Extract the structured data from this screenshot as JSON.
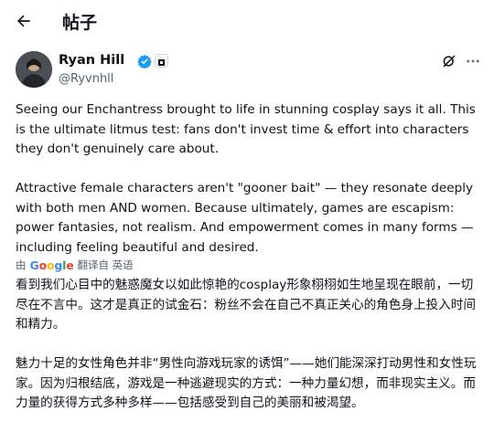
{
  "header": {
    "title": "帖子",
    "back_icon": "arrow-left-icon"
  },
  "author": {
    "name": "Ryan Hill",
    "handle": "@Ryvnhll",
    "verified_icon": "verified-badge-icon",
    "verified_color": "#1d9bf0"
  },
  "actions": {
    "grok_icon": "grok-icon",
    "more_icon": "more-dots-icon"
  },
  "tweet": {
    "text": "Seeing our Enchantress brought to life in stunning cosplay says it all. This is the ultimate litmus test: fans don't invest time & effort into characters they don't genuinely care about.\n\nAttractive female characters aren't \"gooner bait\" — they resonate deeply with both men AND women. Because ultimately, games are escapism: power fantasies, not realism. And empowerment comes in many forms — including feeling beautiful and desired."
  },
  "translation": {
    "by_label": "由",
    "provider": "Google",
    "translated_from_label": "翻译自 英语",
    "text": "看到我们心目中的魅惑魔女以如此惊艳的cosplay形象栩栩如生地呈现在眼前，一切尽在不言中。这才是真正的试金石：粉丝不会在自己不真正关心的角色身上投入时间和精力。\n\n魅力十足的女性角色并非“男性向游戏玩家的诱饵”——她们能深深打动男性和女性玩家。因为归根结底，游戏是一种逃避现实的方式：一种力量幻想，而非现实主义。而力量的获得方式多种多样——包括感受到自己的美丽和被渴望。"
  }
}
